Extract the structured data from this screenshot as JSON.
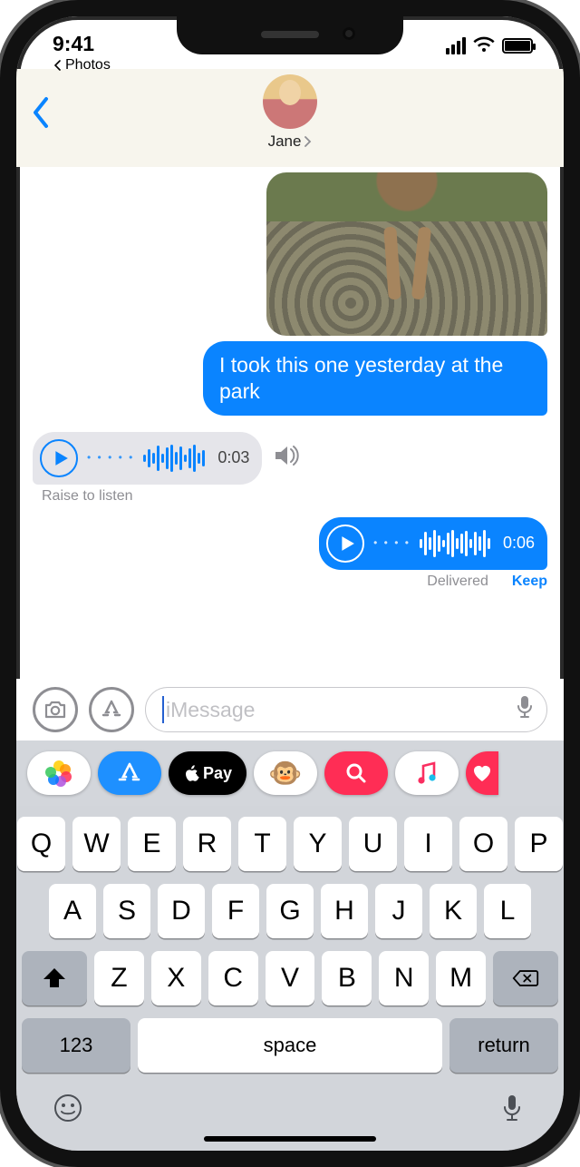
{
  "status": {
    "time": "9:41",
    "back_app": "Photos"
  },
  "nav": {
    "contact_name": "Jane"
  },
  "messages": {
    "out_text": "I took this one yesterday at the park",
    "in_audio": {
      "duration": "0:03",
      "hint": "Raise to listen"
    },
    "out_audio": {
      "duration": "0:06",
      "delivered": "Delivered",
      "keep": "Keep"
    }
  },
  "input": {
    "placeholder": "iMessage"
  },
  "appstrip": {
    "pay_label": "Pay"
  },
  "keyboard": {
    "row1": [
      "Q",
      "W",
      "E",
      "R",
      "T",
      "Y",
      "U",
      "I",
      "O",
      "P"
    ],
    "row2": [
      "A",
      "S",
      "D",
      "F",
      "G",
      "H",
      "J",
      "K",
      "L"
    ],
    "row3": [
      "Z",
      "X",
      "C",
      "V",
      "B",
      "N",
      "M"
    ],
    "numeric": "123",
    "space": "space",
    "return": "return"
  }
}
